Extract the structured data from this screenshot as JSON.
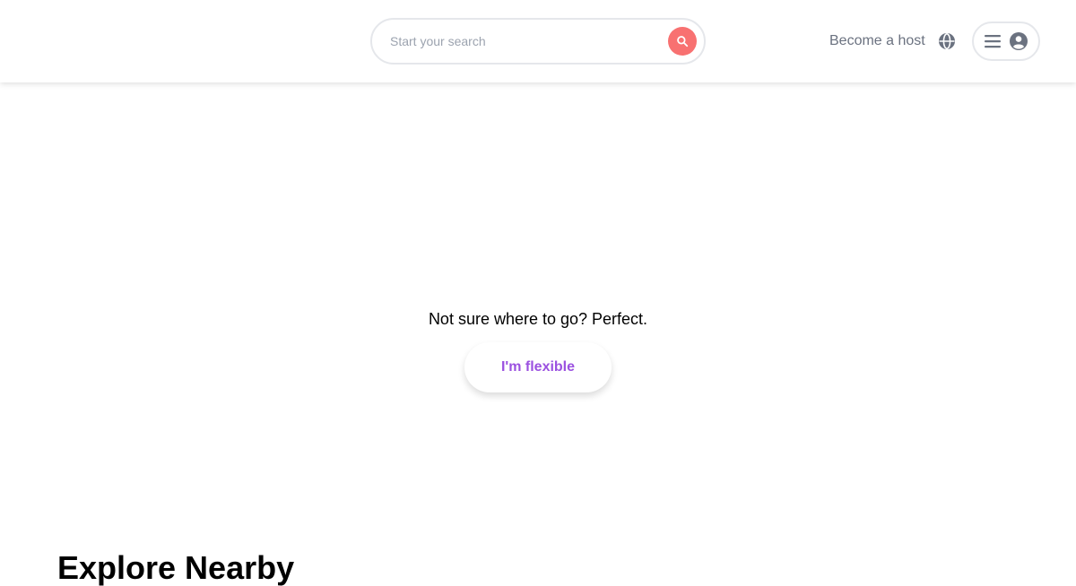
{
  "header": {
    "search": {
      "placeholder": "Start your search",
      "value": ""
    },
    "host_link_label": "Become a host",
    "icons": {
      "search": "search-icon",
      "globe": "globe-icon",
      "menu": "menu-icon",
      "user": "user-circle-icon"
    }
  },
  "hero": {
    "message": "Not sure where to go? Perfect.",
    "cta_label": "I'm flexible"
  },
  "sections": {
    "explore_heading": "Explore Nearby"
  },
  "colors": {
    "search_button": "#f87171",
    "cta_text": "#9b51e0",
    "muted_text": "#6b7280",
    "border": "#e5e7eb"
  }
}
